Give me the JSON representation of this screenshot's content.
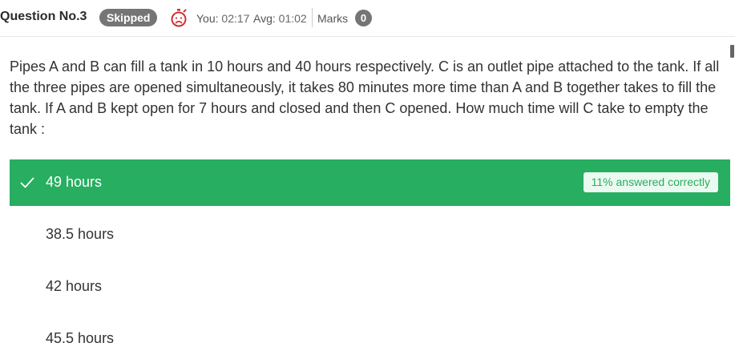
{
  "header": {
    "question_number": "Question No.3",
    "status": "Skipped",
    "you_label": "You:",
    "you_time": "02:17",
    "avg_label": "Avg:",
    "avg_time": "01:02",
    "marks_label": "Marks",
    "marks_value": "0",
    "stopwatch_icon": "sad-stopwatch-icon"
  },
  "question": {
    "text": "Pipes A and B can fill a tank in 10 hours and 40 hours respectively. C is an outlet pipe attached to the tank. If all the three pipes are opened simultaneously, it takes 80 minutes more time than  A and B together takes to fill the tank. If A and B kept open for 7 hours and closed and then C opened. How much time will C take to empty the tank :"
  },
  "options": [
    {
      "label": "49 hours",
      "correct": true,
      "stat": "11% answered correctly"
    },
    {
      "label": "38.5 hours",
      "correct": false
    },
    {
      "label": "42 hours",
      "correct": false
    },
    {
      "label": "45.5 hours",
      "correct": false
    }
  ],
  "colors": {
    "correct_bg": "#27ae60",
    "badge_gray": "#757575",
    "stopwatch_red": "#d32f2f"
  }
}
